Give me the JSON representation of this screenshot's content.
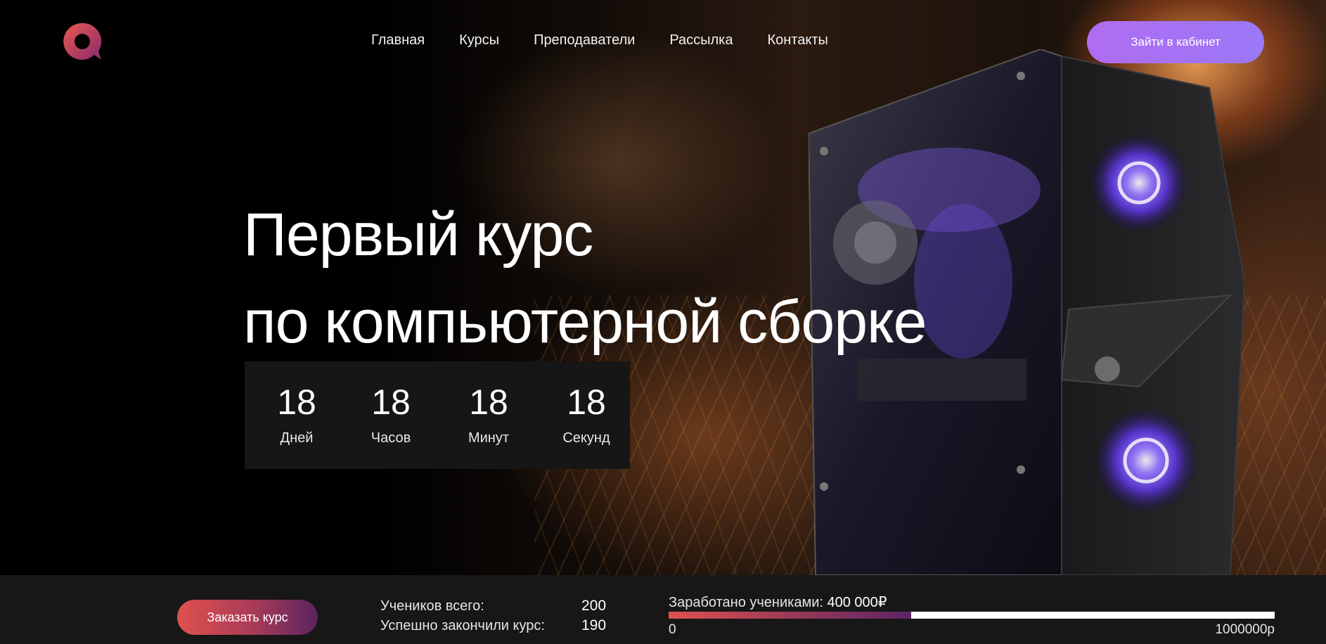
{
  "header": {
    "nav": [
      {
        "label": "Главная"
      },
      {
        "label": "Курсы"
      },
      {
        "label": "Преподаватели"
      },
      {
        "label": "Рассылка"
      },
      {
        "label": "Контакты"
      }
    ],
    "cabinet_button": "Зайти в кабинет"
  },
  "hero": {
    "title_line1": "Первый курс",
    "title_line2": "по компьютерной сборке"
  },
  "countdown": [
    {
      "value": "18",
      "label": "Дней"
    },
    {
      "value": "18",
      "label": "Часов"
    },
    {
      "value": "18",
      "label": "Минут"
    },
    {
      "value": "18",
      "label": "Секунд"
    }
  ],
  "bottom": {
    "order_button": "Заказать курс",
    "students_total_label": "Учеников всего:",
    "students_total_value": "200",
    "finished_label": "Успешно закончили курс:",
    "finished_value": "190",
    "earned_label": "Заработано учениками:",
    "earned_value": "400 000₽",
    "progress_fraction": 0.4,
    "progress_min": "0",
    "progress_max": "1000000р"
  },
  "colors": {
    "accent_purple": "#a574f5",
    "accent_red": "#e0514f",
    "bar_background": "#171717",
    "countdown_background": "#161616"
  }
}
